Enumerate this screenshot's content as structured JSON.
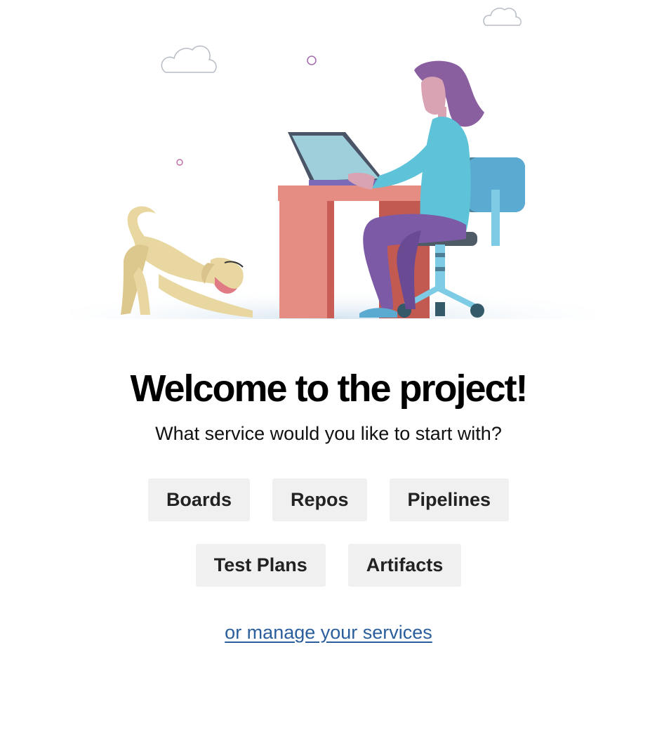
{
  "heading": "Welcome to the project!",
  "subheading": "What service would you like to start with?",
  "services_row1": [
    {
      "label": "Boards"
    },
    {
      "label": "Repos"
    },
    {
      "label": "Pipelines"
    }
  ],
  "services_row2": [
    {
      "label": "Test Plans"
    },
    {
      "label": "Artifacts"
    }
  ],
  "manage_link": "or manage your services",
  "colors": {
    "link": "#2a5e9c",
    "button_bg": "#f0f0f0",
    "desk": "#e58d83",
    "chair": "#5aaad2",
    "hair": "#8a5fa0",
    "shirt": "#5ec2d8",
    "dog": "#e8d7a0"
  }
}
